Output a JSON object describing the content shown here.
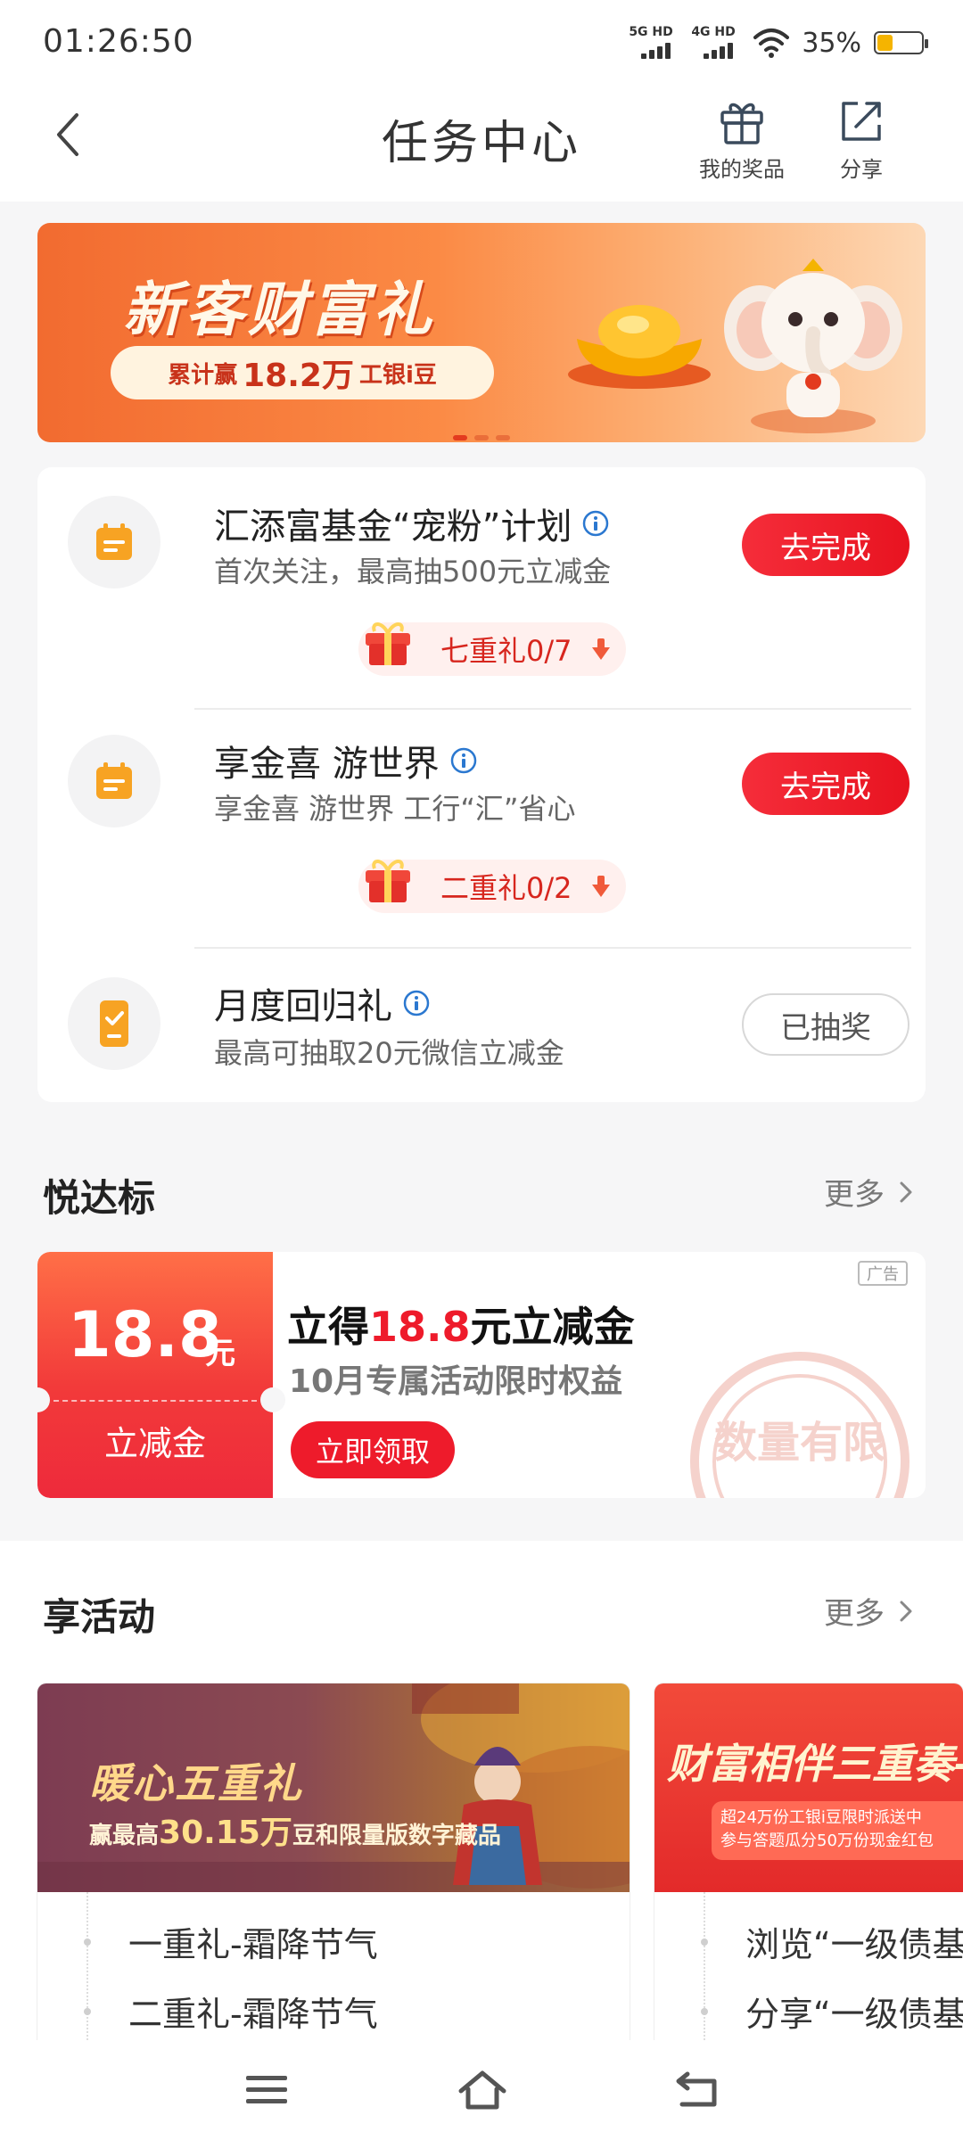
{
  "status": {
    "time": "01:26:50",
    "net1": "5G HD",
    "net2": "4G HD",
    "battery_pct": "35%",
    "battery_level": 0.35,
    "battery_color": "#f5b400"
  },
  "header": {
    "title": "任务中心",
    "back_icon": "chevron-left-icon",
    "actions": [
      {
        "label": "我的奖品",
        "icon": "gift-icon"
      },
      {
        "label": "分享",
        "icon": "share-icon"
      }
    ]
  },
  "banner": {
    "title": "新客财富礼",
    "pill_prefix": "累计赢",
    "pill_value": "18.2万",
    "pill_suffix": "工银i豆",
    "slides": 3,
    "active_slide": 1
  },
  "tasks": [
    {
      "name": "汇添富基金“宠粉”计划",
      "desc": "首次关注，最高抽500元立减金",
      "button": "去完成",
      "icon": "calendar-icon",
      "has_info": true,
      "gift_tag": "七重礼0/7"
    },
    {
      "name": "享金喜 游世界",
      "desc": "享金喜 游世界 工行“汇”省心",
      "button": "去完成",
      "icon": "calendar-icon",
      "has_info": true,
      "gift_tag": "二重礼0/2"
    },
    {
      "name": "月度回归礼",
      "desc": "最高可抽取20元微信立减金",
      "button": "已抽奖",
      "icon": "phone-check-icon",
      "has_info": true
    }
  ],
  "yuedabiao": {
    "title": "悦达标",
    "more": "更多",
    "coupon": {
      "amount": "18.8",
      "unit": "元",
      "type": "立减金",
      "title_prefix": "立得",
      "title_highlight": "18.8",
      "title_suffix": "元立减金",
      "subtitle": "10月专属活动限时权益",
      "button": "立即领取",
      "ad_label": "广告",
      "stamp_text": "数量有限"
    }
  },
  "activities": {
    "title": "享活动",
    "more": "更多",
    "cards": [
      {
        "title": "暖心五重礼",
        "sub_prefix": "赢最高",
        "sub_value": "30.15万",
        "sub_suffix": "豆和限量版数字藏品",
        "items": [
          "一重礼-霜降节气",
          "二重礼-霜降节气"
        ]
      },
      {
        "title": "财富相伴三重奏——",
        "pill_line1": "超24万份工银i豆限时派送中",
        "pill_line2": "参与答题瓜分50万份现金红包",
        "items": [
          "浏览“一级债基",
          "分享“一级债基"
        ]
      }
    ]
  },
  "navbar": {
    "items": [
      "menu-icon",
      "home-icon",
      "back-icon"
    ]
  },
  "colors": {
    "accent_red": "#ee1b2b",
    "banner_orange": "#f26b30",
    "task_icon_orange": "#f7a323"
  }
}
